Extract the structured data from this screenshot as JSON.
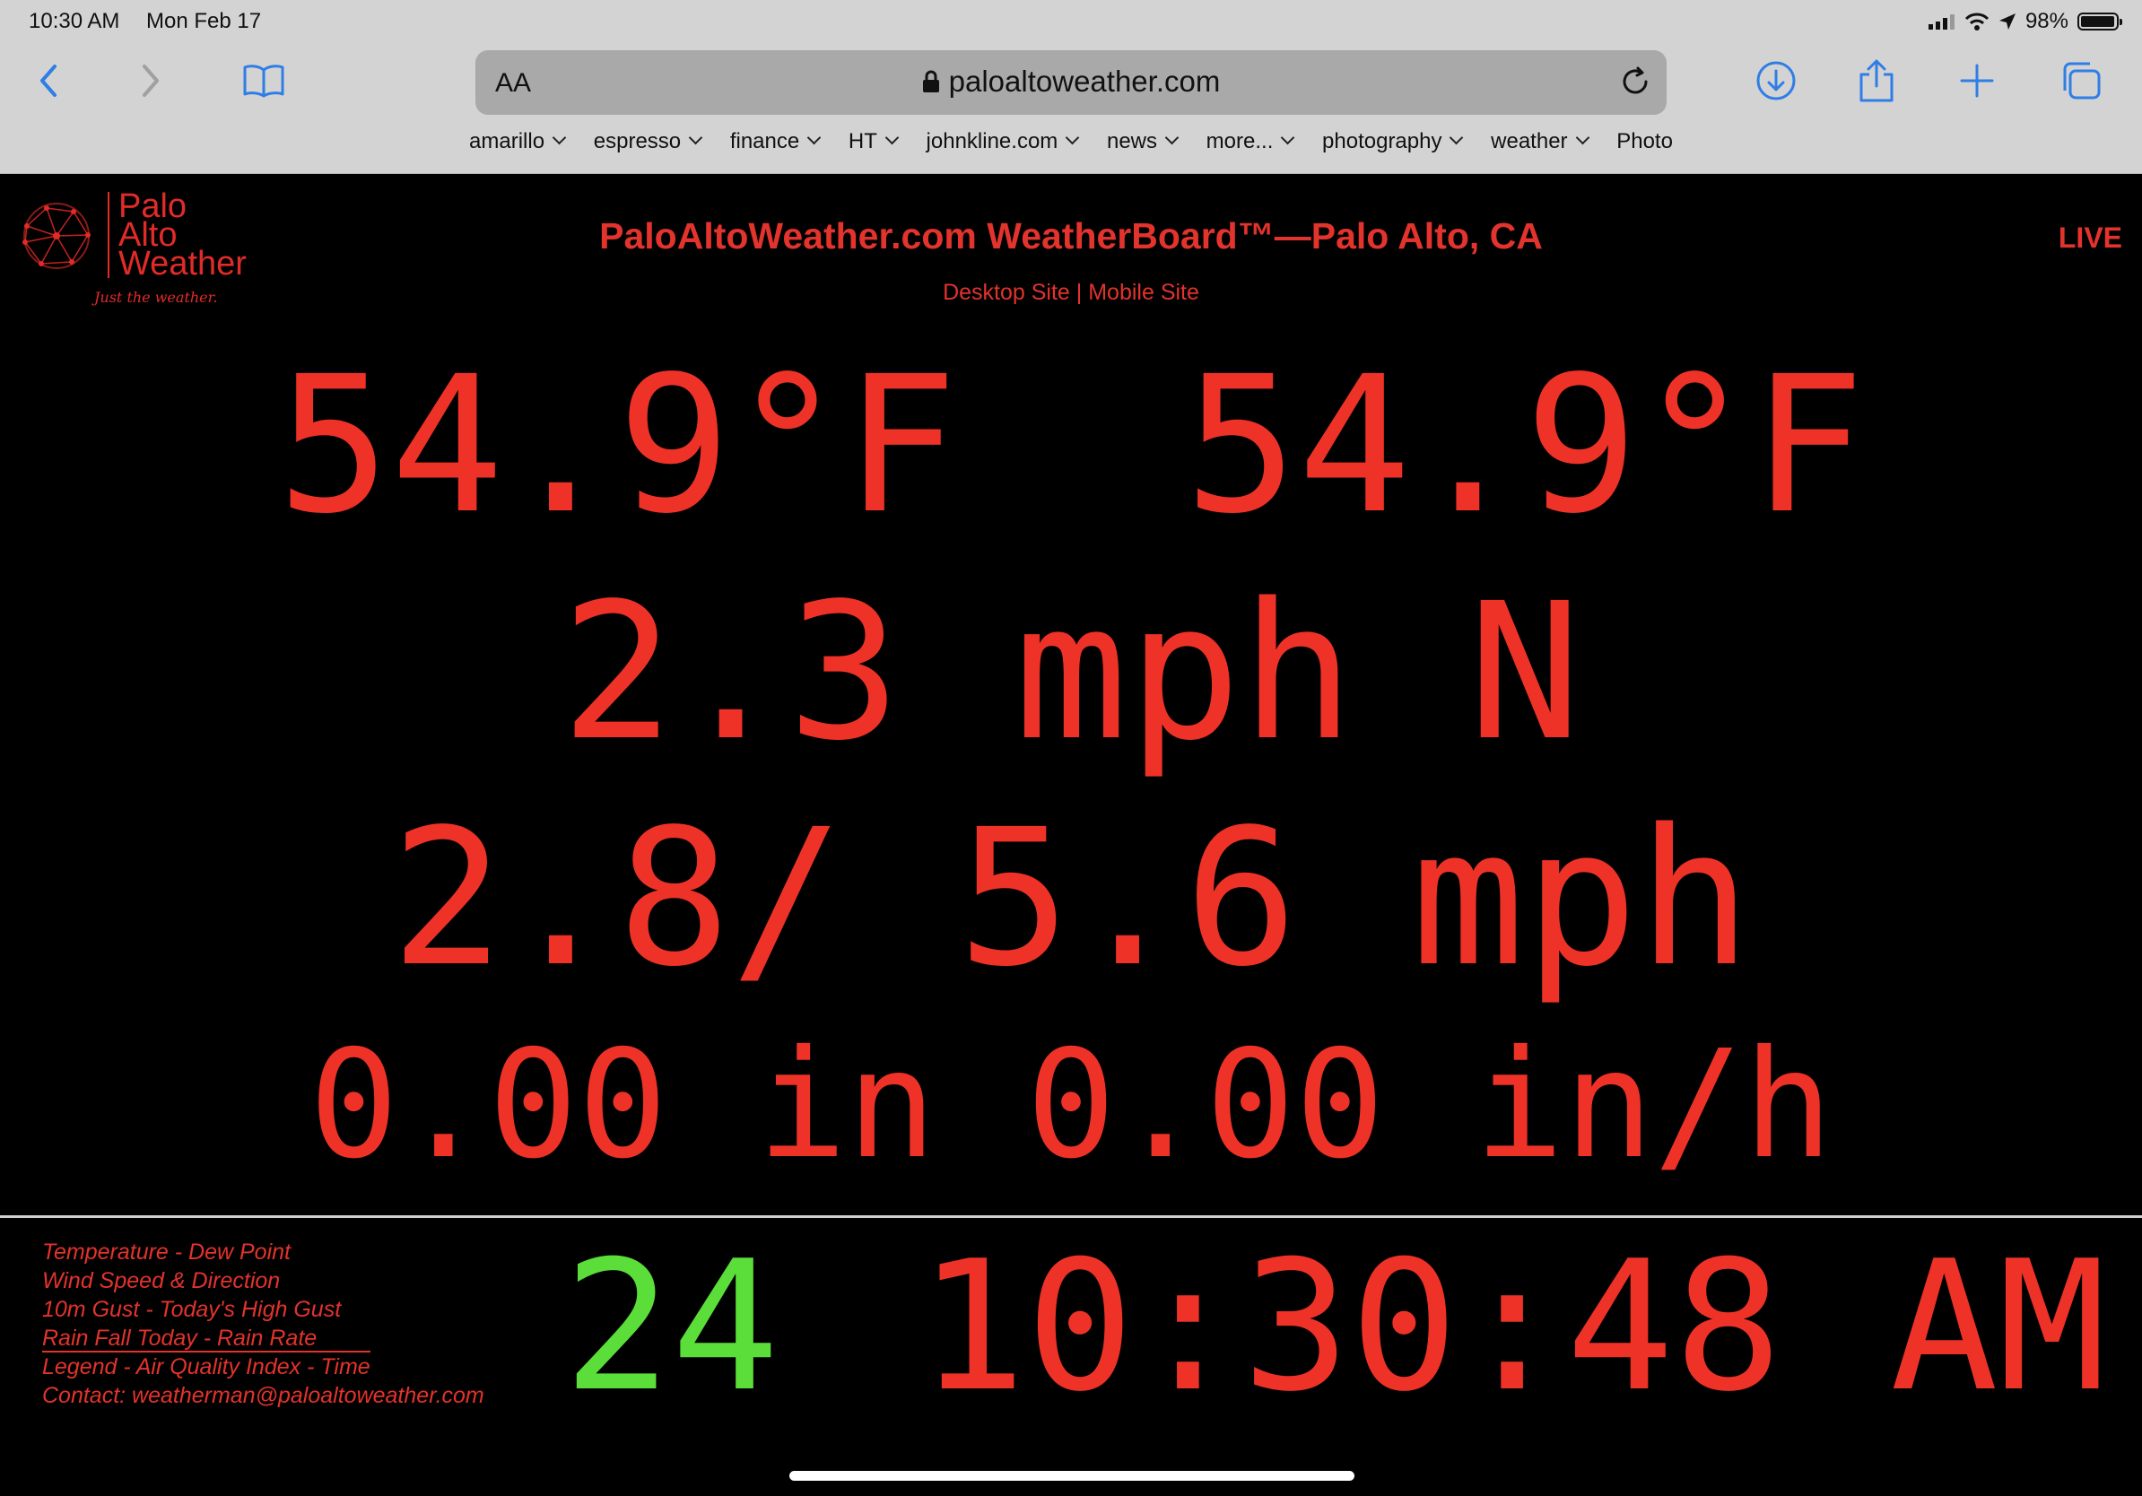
{
  "status": {
    "time": "10:30 AM",
    "date": "Mon Feb 17",
    "battery": "98%"
  },
  "browser": {
    "aa_label": "AA",
    "url": "paloaltoweather.com",
    "accent_color": "#2f7ee6",
    "favorites": [
      {
        "label": "amarillo",
        "folder": true
      },
      {
        "label": "espresso",
        "folder": true
      },
      {
        "label": "finance",
        "folder": true
      },
      {
        "label": "HT",
        "folder": true
      },
      {
        "label": "johnkline.com",
        "folder": true
      },
      {
        "label": "news",
        "folder": true
      },
      {
        "label": "more...",
        "folder": true
      },
      {
        "label": "photography",
        "folder": true
      },
      {
        "label": "weather",
        "folder": true
      },
      {
        "label": "Photo",
        "folder": false
      }
    ]
  },
  "page": {
    "logo": {
      "line1": "Palo",
      "line2": "Alto",
      "line3": "Weather",
      "tagline": "Just the weather."
    },
    "title": "PaloAltoWeather.com WeatherBoard™—Palo Alto, CA",
    "links": {
      "desktop": "Desktop Site",
      "separator": " | ",
      "mobile": "Mobile Site"
    },
    "live": "LIVE",
    "readings": {
      "temp_dew": "54.9°F  54.9°F",
      "wind": "2.3 mph N",
      "gust": "2.8/ 5.6 mph",
      "rain": "0.00 in 0.00 in/h"
    },
    "legend": [
      "Temperature - Dew Point",
      "Wind Speed & Direction",
      "10m Gust - Today's High Gust",
      "Rain Fall Today - Rain Rate",
      "Legend - Air Quality Index - Time",
      "Contact: weatherman@paloaltoweather.com"
    ],
    "aqi": "24",
    "clock": "10:30:48 AM",
    "colors": {
      "primary": "#ee3227",
      "aqi_good": "#5bdd3a",
      "background": "#000000"
    }
  }
}
